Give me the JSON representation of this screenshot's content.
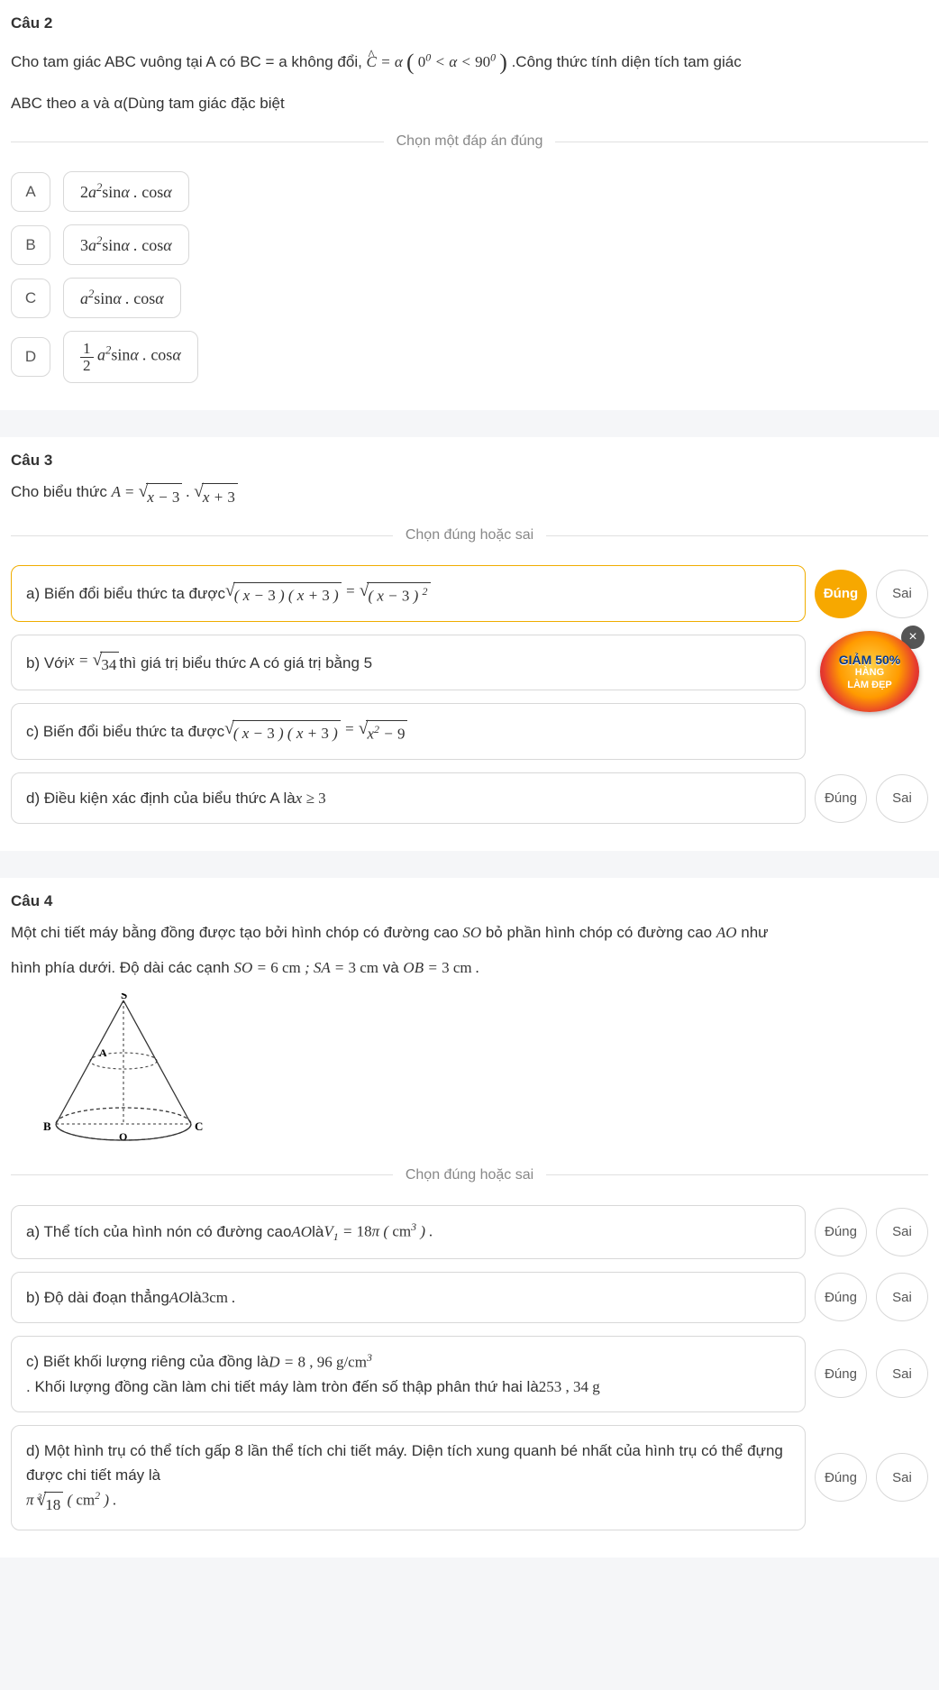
{
  "q2": {
    "title": "Câu 2",
    "text_1": "Cho tam giác ABC vuông tại A có BC = a không đổi, ",
    "text_2": " .Công thức tính diện tích tam giác",
    "text_3": "ABC theo a và α(Dùng tam giác đặc biệt",
    "divider": "Chọn một đáp án đúng",
    "opts": [
      {
        "letter": "A",
        "formula": "2a²sinα . cosα"
      },
      {
        "letter": "B",
        "formula": "3a²sinα . cosα"
      },
      {
        "letter": "C",
        "formula": "a²sinα . cosα"
      },
      {
        "letter": "D",
        "formula": "½ a²sinα . cosα"
      }
    ]
  },
  "q3": {
    "title": "Câu 3",
    "text_1": "Cho biểu thức ",
    "divider": "Chọn đúng hoặc sai",
    "items": [
      {
        "label_pre": "a) Biến đổi biểu thức ta được "
      },
      {
        "label_pre": "b) Với ",
        "label_post": " thì giá trị biểu thức A có giá trị bằng 5"
      },
      {
        "label_pre": "c) Biến đổi biểu thức ta được "
      },
      {
        "label_pre": "d) Điều kiện xác định của biểu thức A là "
      }
    ],
    "btn_true": "Đúng",
    "btn_false": "Sai"
  },
  "q4": {
    "title": "Câu 4",
    "text_1": "Một chi tiết máy bằng đồng được tạo bởi hình chóp có đường cao ",
    "text_2": " bỏ phần hình chóp có đường cao ",
    "text_3": " như",
    "text_4": "hình phía dưới. Độ dài các cạnh ",
    "text_5": " và ",
    "divider": "Chọn đúng hoặc sai",
    "items": [
      {
        "a_pre": "a) Thể tích của hình nón có đường cao ",
        "a_mid": " là "
      },
      {
        "b_pre": "b) Độ dài đoạn thẳng ",
        "b_post": " là "
      },
      {
        "c_pre": "c) Biết khối lượng riêng của đồng là ",
        "c_mid": ". Khối lượng đồng cần làm chi tiết máy làm tròn đến số thập phân thứ hai là "
      },
      {
        "d_pre": "d) Một hình trụ có thể tích gấp 8 lần thể tích chi tiết máy. Diện tích xung quanh bé nhất của hình trụ có thể đựng được chi tiết máy là "
      }
    ],
    "btn_true": "Đúng",
    "btn_false": "Sai",
    "diagram_labels": {
      "S": "S",
      "A": "A",
      "B": "B",
      "C": "C",
      "O": "O"
    }
  },
  "ad": {
    "close": "×",
    "line1": "GIẢM 50%",
    "line2": "HÀNG",
    "line3": "LÀM ĐẸP"
  }
}
